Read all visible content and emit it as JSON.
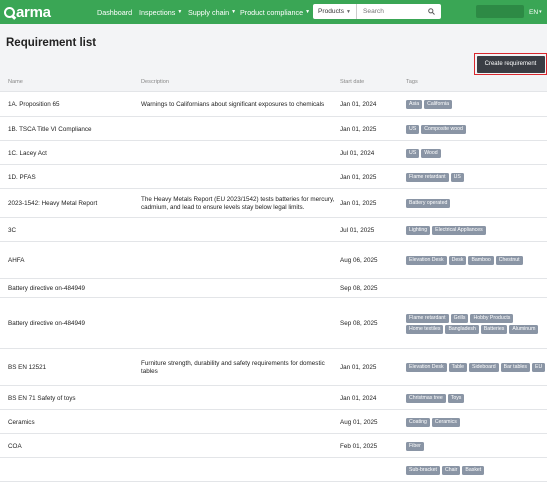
{
  "nav": {
    "logo": "arma",
    "items": [
      {
        "label": "Dashboard",
        "dropdown": false
      },
      {
        "label": "Inspections",
        "dropdown": true
      },
      {
        "label": "Supply chain",
        "dropdown": true
      },
      {
        "label": "Product compliance",
        "dropdown": true
      }
    ],
    "search_scope": "Products",
    "search_placeholder": "Search",
    "language": "EN"
  },
  "page": {
    "title": "Requirement list",
    "create_button": "Create requirement"
  },
  "table": {
    "columns": [
      "Name",
      "Description",
      "Start date",
      "Tags"
    ],
    "rows": [
      {
        "name": "1A. Proposition 65",
        "description": "Warnings to Californians about significant exposures to chemicals",
        "date": "Jan 01, 2024",
        "tags": [
          "Asia",
          "California"
        ]
      },
      {
        "name": "1B. TSCA Title VI Compliance",
        "description": "",
        "date": "Jan 01, 2025",
        "tags": [
          "US",
          "Composite wood"
        ]
      },
      {
        "name": "1C. Lacey Act",
        "description": "",
        "date": "Jul 01, 2024",
        "tags": [
          "US",
          "Wood"
        ]
      },
      {
        "name": "1D. PFAS",
        "description": "",
        "date": "Jan 01, 2025",
        "tags": [
          "Flame retardant",
          "US"
        ]
      },
      {
        "name": "2023-1542: Heavy Metal Report",
        "description": "The Heavy Metals Report (EU 2023/1542) tests batteries for mercury, cadmium, and lead to ensure levels stay below legal limits.",
        "date": "Jan 01, 2025",
        "tags": [
          "Battery operated"
        ]
      },
      {
        "name": "3C",
        "description": "",
        "date": "Jul 01, 2025",
        "tags": [
          "Lighting",
          "Electrical Appliances"
        ]
      },
      {
        "name": "AHFA",
        "description": "",
        "date": "Aug 06, 2025",
        "tags": [
          "Elevation Desk",
          "Desk",
          "Bamboo",
          "Chestnut"
        ]
      },
      {
        "name": "Battery directive on-484949",
        "description": "",
        "date": "Sep 08, 2025",
        "tags": []
      },
      {
        "name": "Battery directive on-484949",
        "description": "",
        "date": "Sep 08, 2025",
        "tags": [
          "Flame retardant",
          "Grills",
          "Hobby Products",
          "Home textiles",
          "Bangladesh",
          "Batteries",
          "Aluminum"
        ]
      },
      {
        "name": "BS EN 12521",
        "description": "Furniture strength, durability and safety requirements for domestic tables",
        "date": "Jan 01, 2025",
        "tags": [
          "Elevation Desk",
          "Table",
          "Sideboard",
          "Bar tables",
          "EU"
        ]
      },
      {
        "name": "BS EN 71 Safety of toys",
        "description": "",
        "date": "Jan 01, 2024",
        "tags": [
          "Christmas tree",
          "Toys"
        ]
      },
      {
        "name": "Ceramics",
        "description": "",
        "date": "Aug 01, 2025",
        "tags": [
          "Coating",
          "Ceramics"
        ]
      },
      {
        "name": "COA",
        "description": "",
        "date": "Feb 01, 2025",
        "tags": [
          "Fiber"
        ]
      },
      {
        "name": "",
        "description": "",
        "date": "",
        "tags": [
          "Sub-bracket",
          "Chair",
          "Basket"
        ]
      }
    ]
  }
}
